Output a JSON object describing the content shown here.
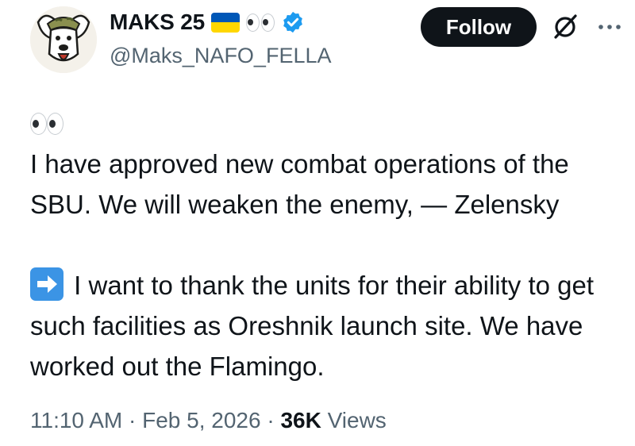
{
  "author": {
    "display_name": "MAKS 25",
    "handle": "@Maks_NAFO_FELLA",
    "verified": true,
    "name_emojis": [
      "ukraine-flag",
      "eyes"
    ]
  },
  "actions": {
    "follow_label": "Follow"
  },
  "tweet": {
    "paragraph1": "I have approved new combat operations of the SBU. We will weaken the enemy, — Zelensky",
    "paragraph2": "I want to thank the units for their ability to get such facilities as Oreshnik launch site. We have worked out the Flamingo."
  },
  "meta": {
    "time": "11:10 AM",
    "separator": "·",
    "date": "Feb 5, 2026",
    "views_count": "36K",
    "views_label": "Views"
  },
  "colors": {
    "flag_blue": "#0057b7",
    "flag_yellow": "#ffd700",
    "verified_blue": "#1d9bf0",
    "arrow_emoji_blue": "#3b94e5",
    "follow_bg": "#0f1419"
  }
}
